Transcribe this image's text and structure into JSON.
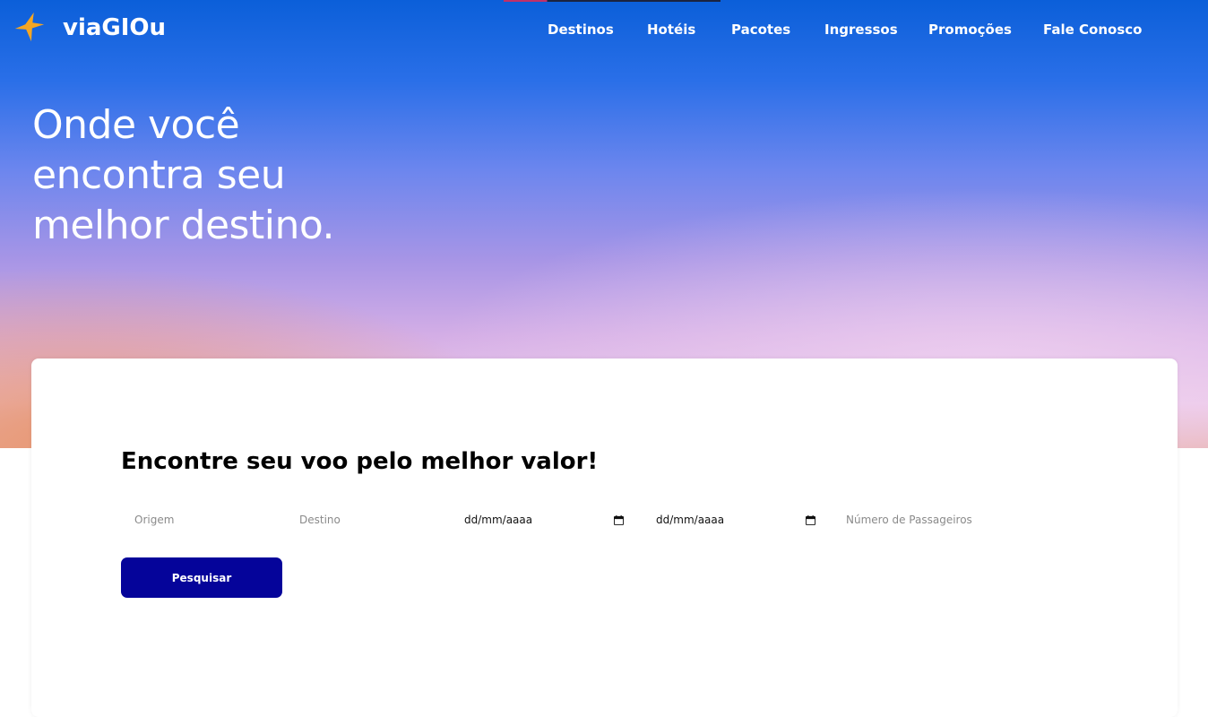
{
  "brand": {
    "name": "viaGIOu",
    "logo_icon": "star-icon",
    "logo_color": "#f5a623"
  },
  "nav": {
    "items": [
      {
        "label": "Destinos"
      },
      {
        "label": "Hotéis"
      },
      {
        "label": "Pacotes"
      },
      {
        "label": "Ingressos"
      },
      {
        "label": "Promoções"
      },
      {
        "label": "Fale Conosco"
      }
    ]
  },
  "hero": {
    "headline": "Onde você encontra seu melhor destino."
  },
  "search": {
    "title": "Encontre seu voo pelo melhor valor!",
    "origin_placeholder": "Origem",
    "destination_placeholder": "Destino",
    "departure_date": "dd/mm/aaaa",
    "return_date": "dd/mm/aaaa",
    "date_icon": "calendar-icon",
    "passengers_placeholder": "Número de Passageiros",
    "button_label": "Pesquisar",
    "button_color": "#05049a"
  }
}
